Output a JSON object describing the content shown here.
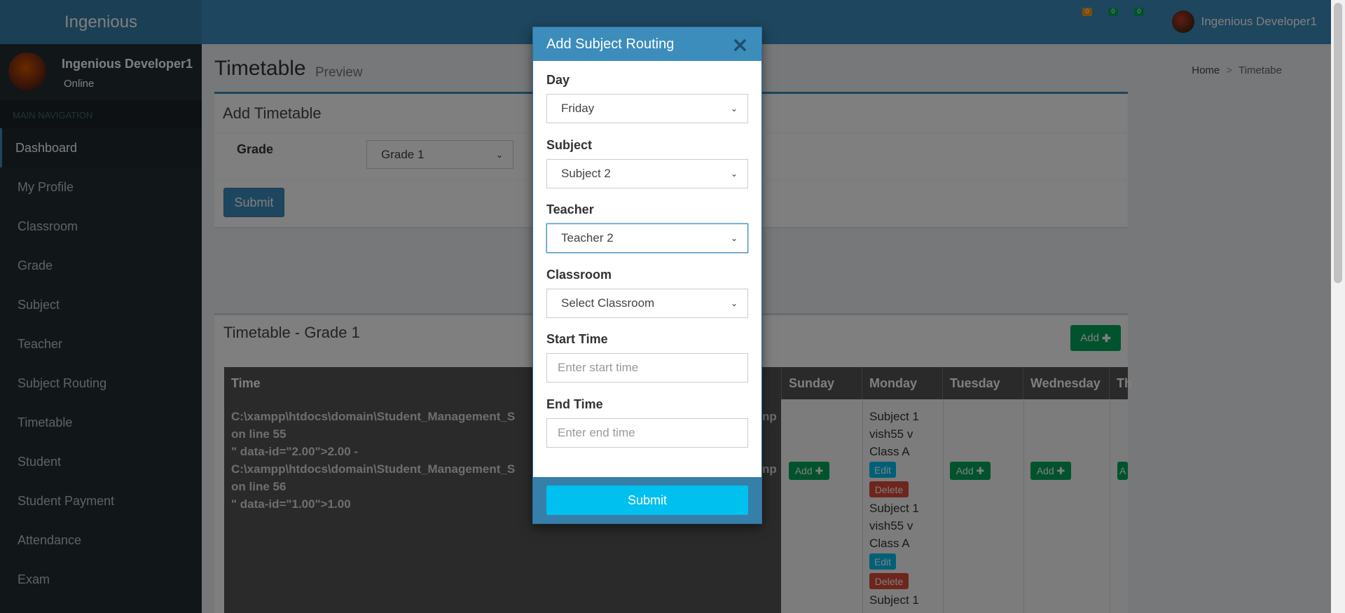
{
  "app": {
    "logo": "Ingenious"
  },
  "header": {
    "toggle_icon": "",
    "notifications": [
      {
        "count": "0",
        "color": "#f39c12"
      },
      {
        "count": "0",
        "color": "#00a65a"
      },
      {
        "count": "0",
        "color": "#00a65a"
      }
    ],
    "user_name": "Ingenious Developer1"
  },
  "sidebar": {
    "user_name": "Ingenious Developer1",
    "user_status": "Online",
    "nav_header": "MAIN NAVIGATION",
    "items": [
      {
        "label": "Dashboard"
      },
      {
        "label": "My Profile"
      },
      {
        "label": "Classroom"
      },
      {
        "label": "Grade"
      },
      {
        "label": "Subject"
      },
      {
        "label": "Teacher"
      },
      {
        "label": "Subject Routing"
      },
      {
        "label": "Timetable"
      },
      {
        "label": "Student"
      },
      {
        "label": "Student Payment"
      },
      {
        "label": "Attendance"
      },
      {
        "label": "Exam"
      }
    ]
  },
  "page": {
    "title": "Timetable",
    "subtitle": "Preview",
    "breadcrumb": {
      "home": "Home",
      "separator": ">",
      "current": "Timetabe"
    }
  },
  "add_timetable": {
    "title": "Add Timetable",
    "grade_label": "Grade",
    "grade_value": "Grade 1",
    "submit_label": "Submit"
  },
  "timetable": {
    "title": "Timetable - Grade 1",
    "add_label": "Add",
    "headers": [
      "Time",
      "Sunday",
      "Monday",
      "Tuesday",
      "Wednesday",
      "Th"
    ],
    "time_lines": [
      "C:\\xampp\\htdocs\\domain\\Student_Management_S",
      "on line 55",
      "\" data-id=\"2.00\">2.00 -",
      "C:\\xampp\\htdocs\\domain\\Student_Management_S",
      "on line 56",
      "\" data-id=\"1.00\">1.00"
    ],
    "overflow_fragments": [
      "np",
      "np"
    ],
    "row_add_label": "Add",
    "partial_add_label": "A",
    "monday_entries": [
      {
        "subject": "Subject 1",
        "teacher": "vish55 v",
        "classroom": "Class A"
      },
      {
        "subject": "Subject 1",
        "teacher": "vish55 v",
        "classroom": "Class A"
      },
      {
        "subject": "Subject 1",
        "teacher": "",
        "classroom": ""
      }
    ],
    "edit_label": "Edit",
    "delete_label": "Delete"
  },
  "modal": {
    "title": "Add Subject Routing",
    "close_icon": "×",
    "day_label": "Day",
    "day_value": "Friday",
    "subject_label": "Subject",
    "subject_value": "Subject 2",
    "teacher_label": "Teacher",
    "teacher_value": "Teacher 2",
    "classroom_label": "Classroom",
    "classroom_value": "Select Classroom",
    "start_label": "Start Time",
    "start_placeholder": "Enter start time",
    "end_label": "End Time",
    "end_placeholder": "Enter end time",
    "submit_label": "Submit"
  }
}
